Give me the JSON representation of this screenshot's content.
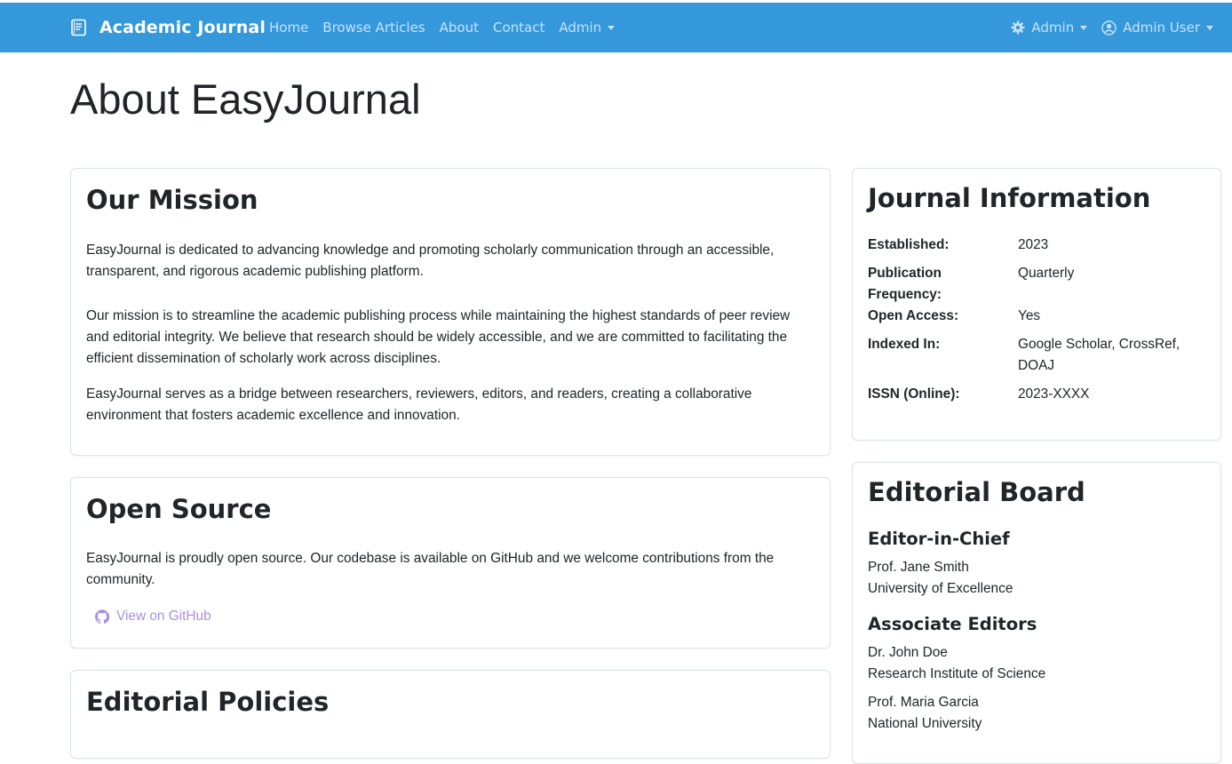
{
  "navbar": {
    "brand": "Academic Journal",
    "links": [
      "Home",
      "Browse Articles",
      "About",
      "Contact",
      "Admin"
    ],
    "right": {
      "admin_label": "Admin",
      "user_label": "Admin User"
    },
    "bg_color": "#3498db"
  },
  "page": {
    "title": "About EasyJournal"
  },
  "mission": {
    "heading": "Our Mission",
    "lead": "EasyJournal is dedicated to advancing knowledge and promoting scholarly communication through an accessible, transparent, and rigorous academic publishing platform.",
    "p1": "Our mission is to streamline the academic publishing process while maintaining the highest standards of peer review and editorial integrity. We believe that research should be widely accessible, and we are committed to facilitating the efficient dissemination of scholarly work across disciplines.",
    "p2": "EasyJournal serves as a bridge between researchers, reviewers, editors, and readers, creating a collaborative environment that fosters academic excellence and innovation."
  },
  "open_source": {
    "heading": "Open Source",
    "text": "EasyJournal is proudly open source. Our codebase is available on GitHub and we welcome contributions from the community.",
    "link_label": "View on GitHub",
    "link_color": "#a991e0"
  },
  "policies": {
    "heading": "Editorial Policies"
  },
  "journal_info": {
    "heading": "Journal Information",
    "rows": [
      {
        "label": "Established:",
        "value": "2023"
      },
      {
        "label": "Publication Frequency:",
        "value": "Quarterly"
      },
      {
        "label": "Open Access:",
        "value": "Yes"
      },
      {
        "label": "Indexed In:",
        "value": "Google Scholar, CrossRef, DOAJ"
      },
      {
        "label": "ISSN (Online):",
        "value": "2023-XXXX"
      }
    ]
  },
  "editorial_board": {
    "heading": "Editorial Board",
    "chief_heading": "Editor-in-Chief",
    "chief": {
      "name": "Prof. Jane Smith",
      "affiliation": "University of Excellence"
    },
    "associate_heading": "Associate Editors",
    "associates": [
      {
        "name": "Dr. John Doe",
        "affiliation": "Research Institute of Science"
      },
      {
        "name": "Prof. Maria Garcia",
        "affiliation": "National University"
      }
    ]
  }
}
